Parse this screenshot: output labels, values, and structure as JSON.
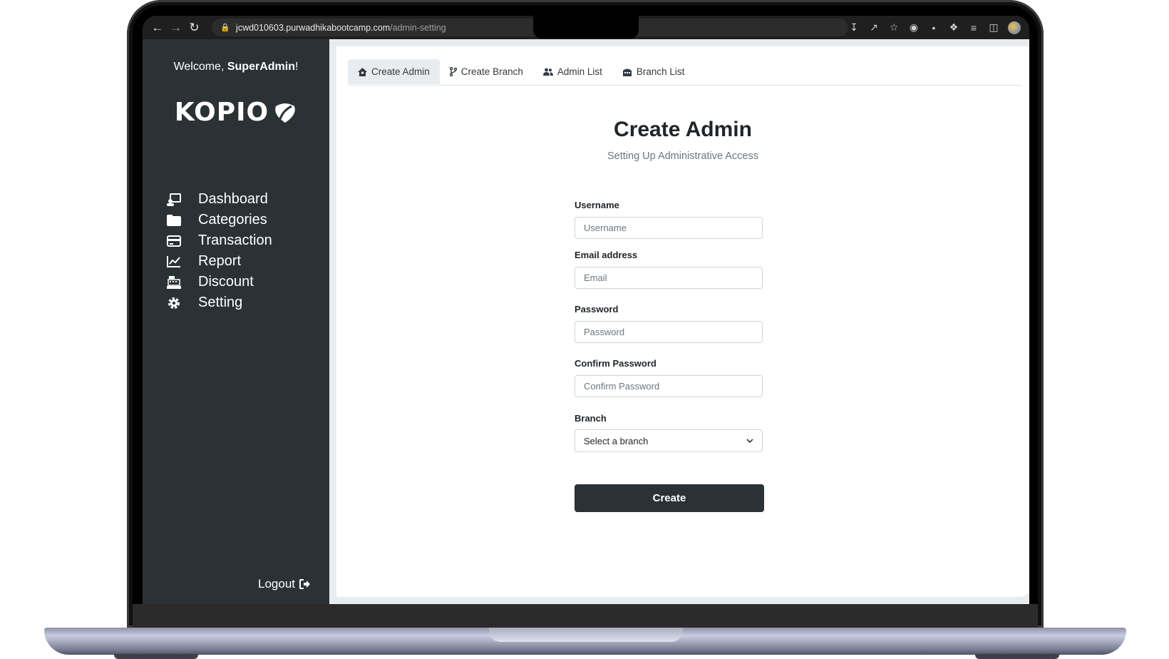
{
  "browser": {
    "url_host": "jcwd010603.purwadhikabootcamp.com",
    "url_path": "/admin-setting"
  },
  "sidebar": {
    "welcome_prefix": "Welcome, ",
    "welcome_user": "SuperAdmin",
    "welcome_suffix": "!",
    "logo_text": "KOPIO",
    "items": [
      {
        "label": "Dashboard",
        "icon": "dashboard-icon"
      },
      {
        "label": "Categories",
        "icon": "folder-icon"
      },
      {
        "label": "Transaction",
        "icon": "credit-card-icon"
      },
      {
        "label": "Report",
        "icon": "chart-line-icon"
      },
      {
        "label": "Discount",
        "icon": "cash-register-icon"
      },
      {
        "label": "Setting",
        "icon": "gear-icon"
      }
    ],
    "logout_label": "Logout"
  },
  "tabs": [
    {
      "label": "Create Admin",
      "icon": "user-home-icon",
      "active": true
    },
    {
      "label": "Create Branch",
      "icon": "code-branch-icon",
      "active": false
    },
    {
      "label": "Admin List",
      "icon": "users-icon",
      "active": false
    },
    {
      "label": "Branch List",
      "icon": "building-icon",
      "active": false
    }
  ],
  "form": {
    "title": "Create Admin",
    "subtitle": "Setting Up Administrative Access",
    "username_label": "Username",
    "username_placeholder": "Username",
    "email_label": "Email address",
    "email_placeholder": "Email",
    "password_label": "Password",
    "password_placeholder": "Password",
    "confirm_label": "Confirm Password",
    "confirm_placeholder": "Confirm Password",
    "branch_label": "Branch",
    "branch_selected": "Select a branch",
    "submit_label": "Create"
  },
  "colors": {
    "sidebar_bg": "#2b3235",
    "button_bg": "#2b3235",
    "content_bg": "#ffffff"
  }
}
